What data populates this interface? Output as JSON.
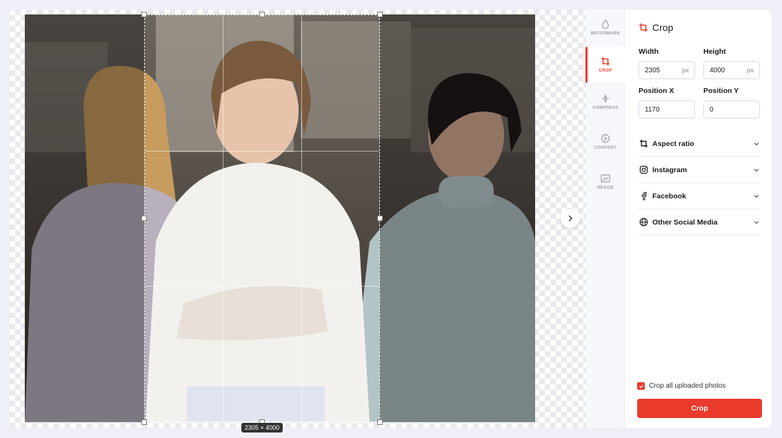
{
  "tools": [
    {
      "id": "watermark",
      "label": "WATERMARK",
      "icon": "watermark-icon"
    },
    {
      "id": "crop",
      "label": "CROP",
      "icon": "crop-icon",
      "active": true
    },
    {
      "id": "compress",
      "label": "COMPRESS",
      "icon": "compress-icon"
    },
    {
      "id": "convert",
      "label": "CONVERT",
      "icon": "convert-icon"
    },
    {
      "id": "resize",
      "label": "RESIZE",
      "icon": "resize-icon"
    }
  ],
  "panel": {
    "title": "Crop",
    "width_label": "Width",
    "width_value": "2305",
    "width_unit": "px",
    "height_label": "Height",
    "height_value": "4000",
    "height_unit": "px",
    "posx_label": "Position X",
    "posx_value": "1170",
    "posy_label": "Position Y",
    "posy_value": "0",
    "sections": [
      {
        "label": "Aspect ratio",
        "icon": "crop-icon"
      },
      {
        "label": "Instagram",
        "icon": "instagram-icon"
      },
      {
        "label": "Facebook",
        "icon": "facebook-icon"
      },
      {
        "label": "Other Social Media",
        "icon": "globe-icon"
      }
    ],
    "crop_all_label": "Crop all uploaded photos",
    "crop_all_checked": true,
    "crop_button": "Crop"
  },
  "canvas": {
    "dimension_label": "2305 × 4000"
  },
  "colors": {
    "accent": "#ea3a2c",
    "background": "#eeeff7"
  }
}
